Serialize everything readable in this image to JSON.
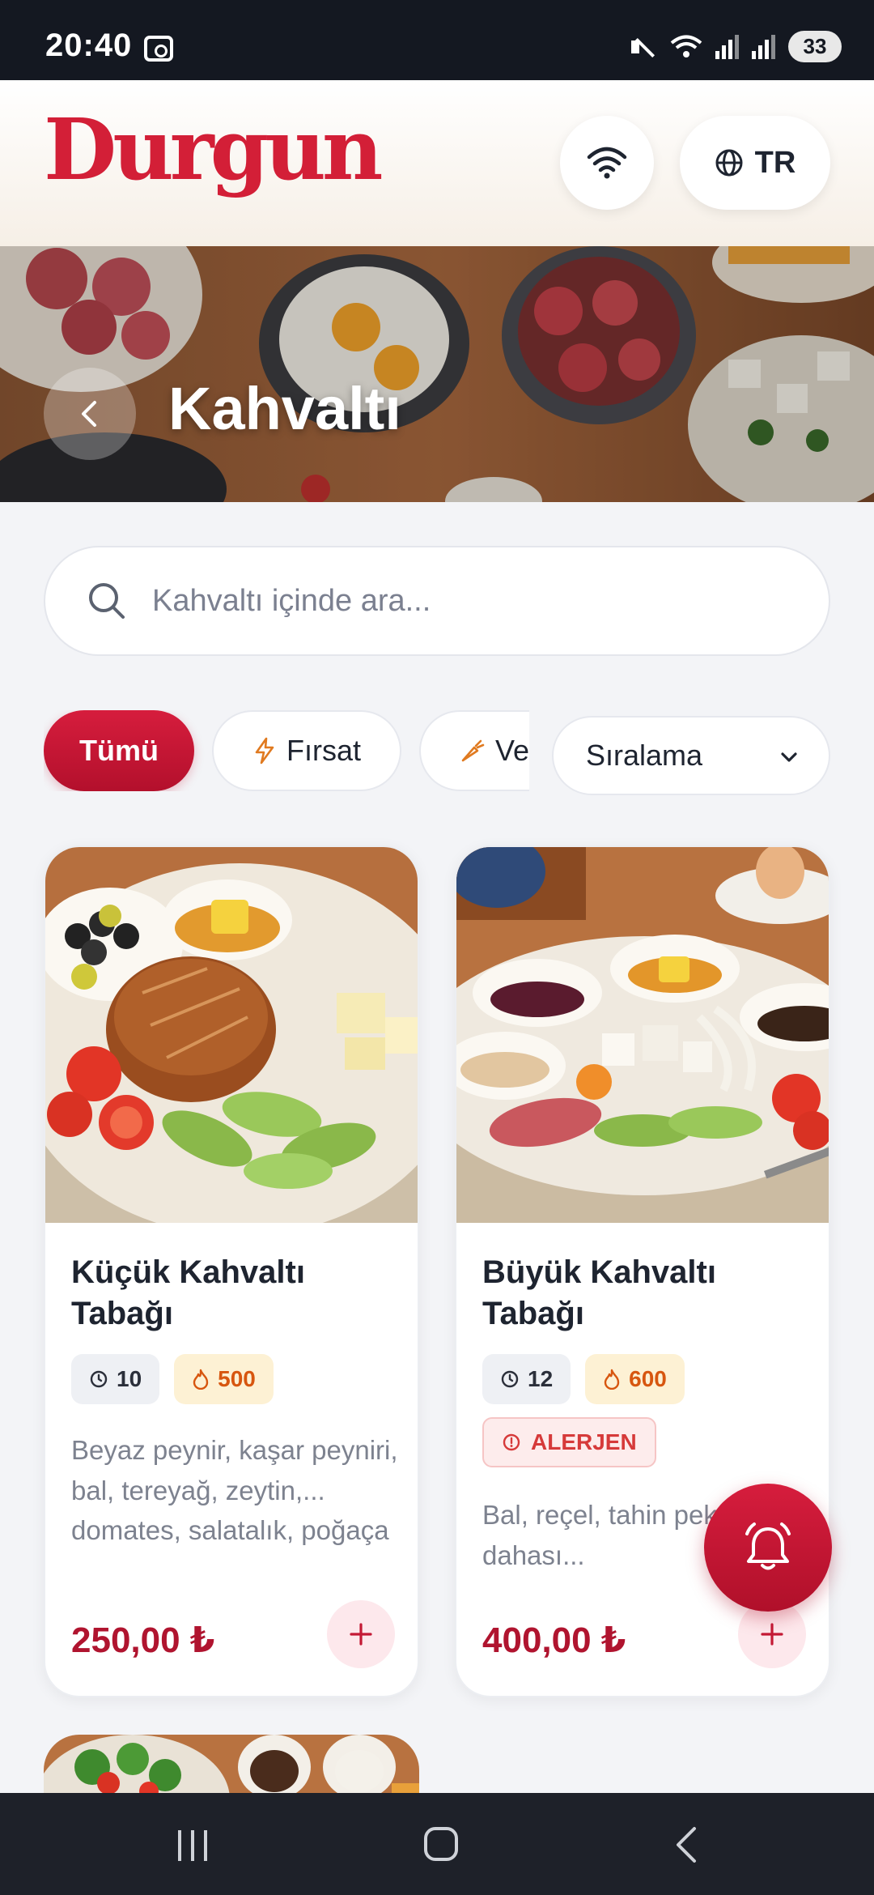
{
  "status_bar": {
    "time": "20:40",
    "battery": "33"
  },
  "header": {
    "brand": "Durgun",
    "language": "TR"
  },
  "hero": {
    "title": "Kahvaltı"
  },
  "search": {
    "placeholder": "Kahvaltı içinde ara..."
  },
  "filters": {
    "all": "Tümü",
    "deal": "Fırsat",
    "vegan": "Vegan",
    "sort": "Sıralama"
  },
  "products": [
    {
      "title": "Küçük Kahvaltı Tabağı",
      "time": "10",
      "calories": "500",
      "description": "Beyaz peynir, kaşar peyniri, bal, tereyağ, zeytin,... domates, salatalık, poğaça",
      "price": "250,00 ₺"
    },
    {
      "title": "Büyük Kahvaltı Tabağı",
      "time": "12",
      "calories": "600",
      "allergen": "ALERJEN",
      "description": "Bal, reçel, tahin pekmez ve dahası...",
      "price": "400,00 ₺"
    }
  ],
  "colors": {
    "brand": "#d31f37",
    "price": "#b0142f",
    "calorie_badge": "#fdf1d4",
    "allergen": "#d63a3a"
  },
  "icons": {
    "wifi": "wifi-icon",
    "globe": "globe-icon",
    "back": "chevron-left-icon",
    "search": "search-icon",
    "deal": "bolt-icon",
    "vegan": "carrot-icon",
    "sort": "chevron-down-icon",
    "time": "clock-icon",
    "calories": "flame-icon",
    "allergen": "alert-circle-icon",
    "add": "plus-icon",
    "notify": "bell-icon"
  }
}
